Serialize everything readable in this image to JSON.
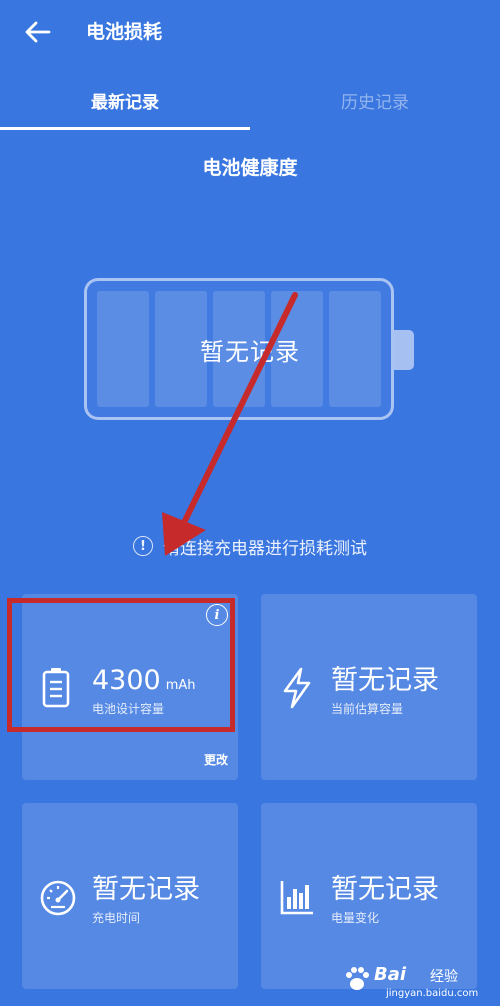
{
  "header": {
    "title": "电池损耗",
    "back_icon": "arrow-left-icon"
  },
  "tabs": [
    {
      "label": "最新记录",
      "active": true
    },
    {
      "label": "历史记录",
      "active": false
    }
  ],
  "section": {
    "title": "电池健康度"
  },
  "battery": {
    "status_text": "暂无记录"
  },
  "hint": {
    "icon": "exclamation-circle-icon",
    "text": "请连接充电器进行损耗测试"
  },
  "cards": [
    {
      "icon": "battery-icon",
      "value": "4300",
      "unit": "mAh",
      "label": "电池设计容量",
      "info_icon": "i",
      "edit_label": "更改"
    },
    {
      "icon": "lightning-icon",
      "value": "暂无记录",
      "label": "当前估算容量"
    },
    {
      "icon": "speedometer-icon",
      "value": "暂无记录",
      "label": "充电时间"
    },
    {
      "icon": "bar-chart-icon",
      "value": "暂无记录",
      "label": "电量变化"
    }
  ],
  "watermark": {
    "brand": "Bai",
    "brand_cn": "经验",
    "url": "jingyan.baidu.com"
  },
  "colors": {
    "background": "#3a76e0",
    "annotation": "#c62a2a"
  }
}
